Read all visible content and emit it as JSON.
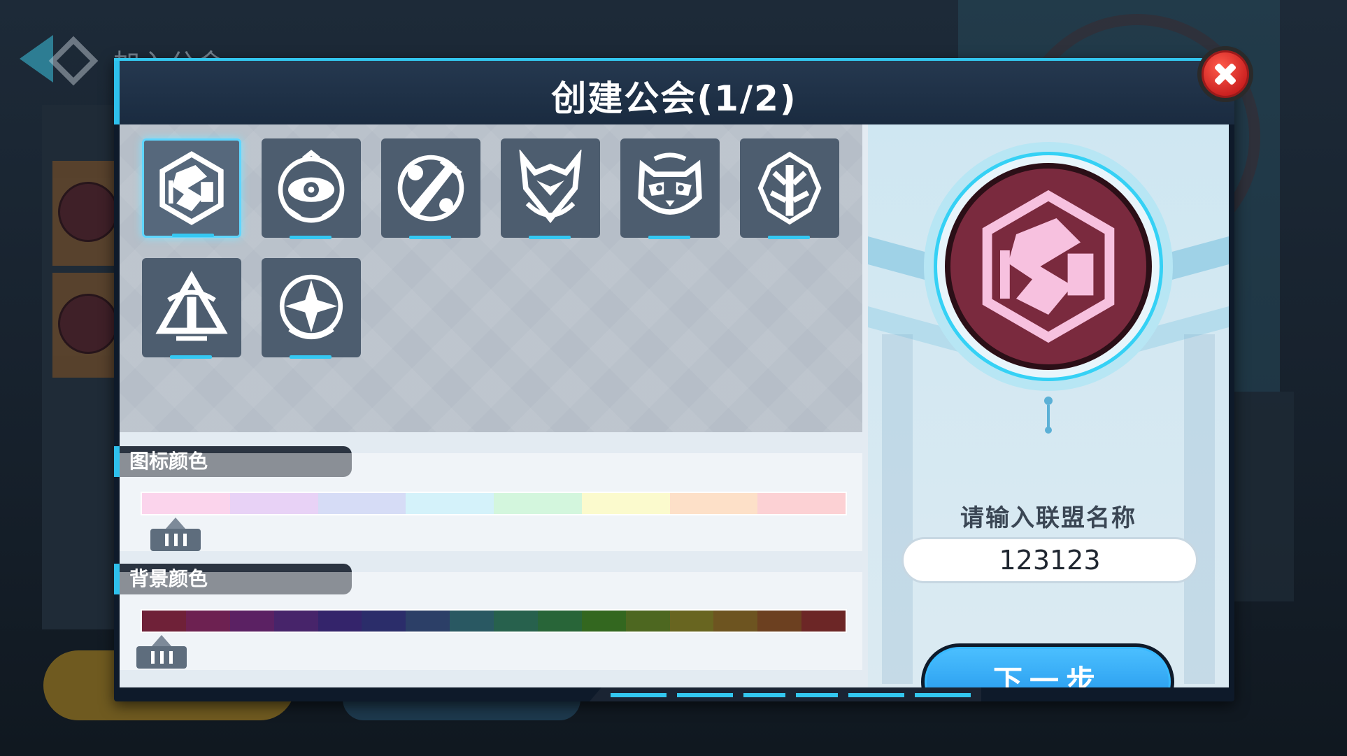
{
  "background": {
    "back_label": "加入公会"
  },
  "dialog": {
    "title": "创建公会(1/2)",
    "emblems": [
      {
        "icon": "tech-crest-icon",
        "selected": true
      },
      {
        "icon": "eye-crest-icon",
        "selected": false
      },
      {
        "icon": "sword-crest-icon",
        "selected": false
      },
      {
        "icon": "horned-shield-icon",
        "selected": false
      },
      {
        "icon": "raccoon-icon",
        "selected": false
      },
      {
        "icon": "tree-crest-icon",
        "selected": false
      },
      {
        "icon": "scales-crest-icon",
        "selected": false
      },
      {
        "icon": "star-crest-icon",
        "selected": false
      }
    ],
    "icon_color": {
      "label": "图标颜色",
      "swatches": [
        "#fbd4ec",
        "#e8d2f6",
        "#d6dcf6",
        "#d4f2fa",
        "#d3f6dd",
        "#fbfacd",
        "#fde0c8",
        "#fcd1d4"
      ],
      "selected_index": 0
    },
    "bg_color": {
      "label": "背景颜色",
      "swatches": [
        "#6f2138",
        "#6d2151",
        "#5b2163",
        "#47246a",
        "#34246b",
        "#2b2d6a",
        "#2c3f67",
        "#295862",
        "#27614d",
        "#286538",
        "#33671f",
        "#4d6720",
        "#686520",
        "#6d5420",
        "#6c4020",
        "#6c2626"
      ],
      "selected_index": 0
    },
    "preview": {
      "icon": "tech-crest-icon",
      "icon_color": "#f7c1df",
      "bg_color": "#7a2a3e"
    },
    "name_prompt": "请输入联盟名称",
    "name_value": "123123",
    "next_button": "下一步"
  }
}
